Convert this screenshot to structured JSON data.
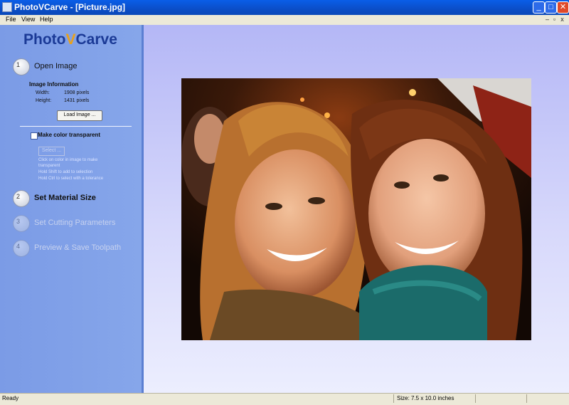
{
  "window": {
    "title": "PhotoVCarve - [Picture.jpg]"
  },
  "menu": [
    "File",
    "View",
    "Help"
  ],
  "sidebar": {
    "logo_main": "Photo",
    "logo_v": "V",
    "logo_end": "Carve",
    "steps": [
      {
        "number": "1",
        "label": "Open Image"
      },
      {
        "number": "2",
        "label": "Set Material Size"
      },
      {
        "number": "3",
        "label": "Set Cutting Parameters"
      },
      {
        "number": "4",
        "label": "Preview & Save Toolpath"
      }
    ],
    "image_info": {
      "title": "Image Information",
      "width_label": "Width:",
      "width_value": "1908 pixels",
      "height_label": "Height:",
      "height_value": "1431 pixels"
    },
    "load_button": "Load Image ...",
    "transparent_label": "Make color transparent",
    "select_button": "Select ...",
    "help": [
      "Click on color in image to make",
      "transparent",
      "Hold Shift to add to selection",
      "Hold Ctrl to select with a tolerance"
    ]
  },
  "statusbar": {
    "status": "Ready",
    "size": "Size: 7.5 x 10.0 inches"
  },
  "colors": {
    "title_bar": "#0b4ec8",
    "sidebar": "#7f9fe7",
    "logo": "#1b3a96",
    "logo_accent": "#e9a11a",
    "canvas": "#c5c7f8"
  }
}
